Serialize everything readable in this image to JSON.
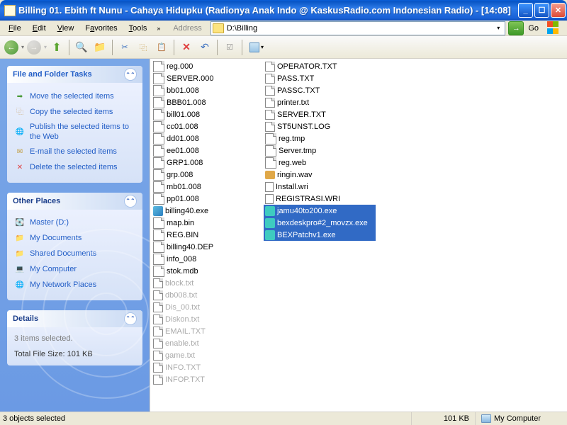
{
  "title": "Billing          01. Ebith ft Nunu - Cahaya Hidupku (Radionya Anak Indo @ KaskusRadio.com Indonesian Radio) - [14:08]",
  "menu": {
    "file": "File",
    "edit": "Edit",
    "view": "View",
    "favorites": "Favorites",
    "tools": "Tools"
  },
  "address": {
    "label": "Address",
    "path": "D:\\Billing",
    "go": "Go"
  },
  "sidebar": {
    "tasks": {
      "title": "File and Folder Tasks",
      "move": "Move the selected items",
      "copy": "Copy the selected items",
      "publish": "Publish the selected items to the Web",
      "email": "E-mail the selected items",
      "delete": "Delete the selected items"
    },
    "places": {
      "title": "Other Places",
      "master": "Master (D:)",
      "mydocs": "My Documents",
      "shared": "Shared Documents",
      "mycomp": "My Computer",
      "netplaces": "My Network Places"
    },
    "details": {
      "title": "Details",
      "selected": "3 items selected.",
      "size": "Total File Size: 101 KB"
    }
  },
  "files": {
    "col1": [
      {
        "n": "reg.000",
        "t": "doc"
      },
      {
        "n": "SERVER.000",
        "t": "doc"
      },
      {
        "n": "bb01.008",
        "t": "doc"
      },
      {
        "n": "BBB01.008",
        "t": "doc"
      },
      {
        "n": "bill01.008",
        "t": "doc"
      },
      {
        "n": "cc01.008",
        "t": "doc"
      },
      {
        "n": "dd01.008",
        "t": "doc"
      },
      {
        "n": "ee01.008",
        "t": "doc"
      },
      {
        "n": "GRP1.008",
        "t": "doc"
      },
      {
        "n": "grp.008",
        "t": "doc"
      },
      {
        "n": "mb01.008",
        "t": "doc"
      },
      {
        "n": "pp01.008",
        "t": "doc"
      },
      {
        "n": "billing40.exe",
        "t": "exe"
      },
      {
        "n": "map.bin",
        "t": "doc"
      },
      {
        "n": "REG.BIN",
        "t": "doc"
      },
      {
        "n": "billing40.DEP",
        "t": "doc"
      },
      {
        "n": "info_008",
        "t": "doc"
      },
      {
        "n": "stok.mdb",
        "t": "doc"
      },
      {
        "n": "block.txt",
        "t": "txt",
        "m": true
      },
      {
        "n": "db008.txt",
        "t": "txt",
        "m": true
      },
      {
        "n": "Dis_00.txt",
        "t": "txt",
        "m": true
      },
      {
        "n": "Diskon.txt",
        "t": "txt",
        "m": true
      },
      {
        "n": "EMAIL.TXT",
        "t": "txt",
        "m": true
      },
      {
        "n": "enable.txt",
        "t": "txt",
        "m": true
      },
      {
        "n": "game.txt",
        "t": "txt",
        "m": true
      },
      {
        "n": "INFO.TXT",
        "t": "txt",
        "m": true
      },
      {
        "n": "INFOP.TXT",
        "t": "txt",
        "m": true
      }
    ],
    "col2": [
      {
        "n": "OPERATOR.TXT",
        "t": "txt"
      },
      {
        "n": "PASS.TXT",
        "t": "txt"
      },
      {
        "n": "PASSC.TXT",
        "t": "txt"
      },
      {
        "n": "printer.txt",
        "t": "txt"
      },
      {
        "n": "SERVER.TXT",
        "t": "txt"
      },
      {
        "n": "ST5UNST.LOG",
        "t": "txt"
      },
      {
        "n": "reg.tmp",
        "t": "doc"
      },
      {
        "n": "Server.tmp",
        "t": "doc"
      },
      {
        "n": "reg.web",
        "t": "doc"
      },
      {
        "n": "ringin.wav",
        "t": "wav"
      },
      {
        "n": "Install.wri",
        "t": "wri"
      },
      {
        "n": "REGISTRASI.WRI",
        "t": "wri"
      },
      {
        "n": "jamu40to200.exe",
        "t": "exe2",
        "s": true
      },
      {
        "n": "bexdeskpro#2_movzx.exe",
        "t": "exe2",
        "s": true
      },
      {
        "n": "BEXPatchv1.exe",
        "t": "exe2",
        "s": true
      }
    ]
  },
  "status": {
    "left": "3 objects selected",
    "size": "101 KB",
    "loc": "My Computer"
  }
}
